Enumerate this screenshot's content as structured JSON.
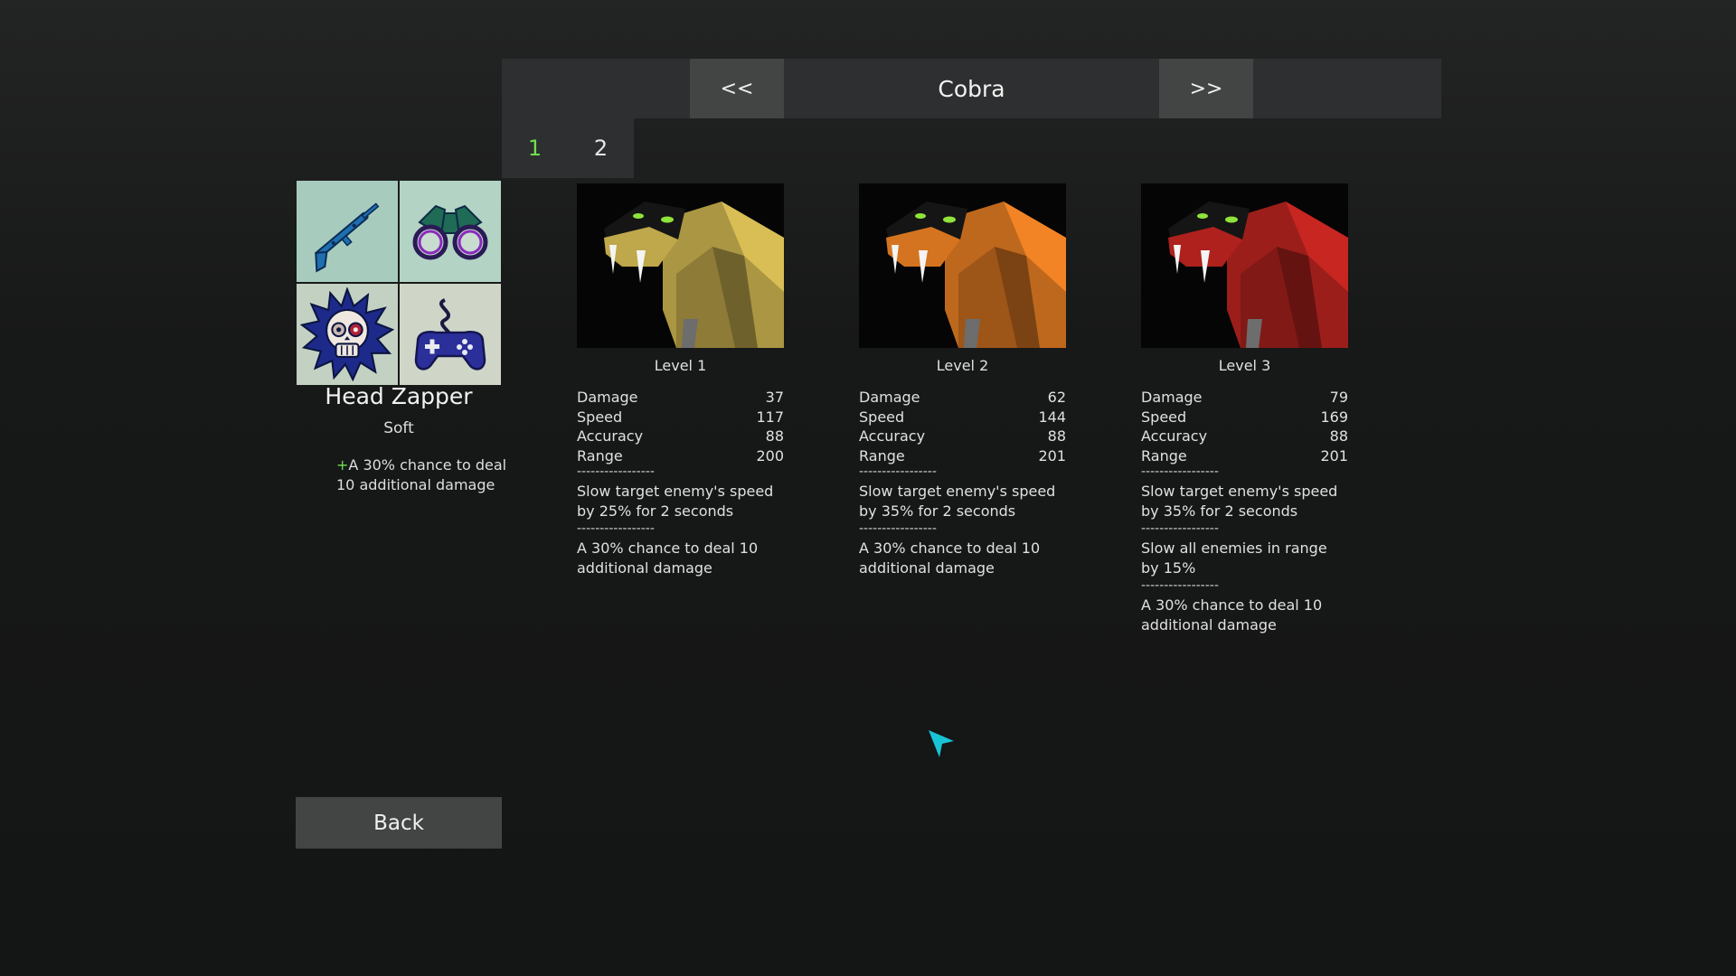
{
  "header": {
    "prev_label": "<<",
    "next_label": ">>",
    "title": "Cobra"
  },
  "pages": [
    {
      "label": "1",
      "active": true
    },
    {
      "label": "2",
      "active": false
    }
  ],
  "upgrade": {
    "name": "Head Zapper",
    "type": "Soft",
    "bonus_prefix": "+",
    "bonus_text": "A 30% chance to deal 10 additional damage",
    "icons": [
      "rifle-icon",
      "binoculars-icon",
      "skull-icon",
      "gamepad-icon"
    ]
  },
  "levels": [
    {
      "label": "Level 1",
      "color": "#c9b04f",
      "stats": [
        {
          "name": "Damage",
          "value": "37"
        },
        {
          "name": "Speed",
          "value": "117"
        },
        {
          "name": "Accuracy",
          "value": "88"
        },
        {
          "name": "Range",
          "value": "200"
        }
      ],
      "effects": [
        "Slow target enemy's speed by 25% for 2 seconds",
        "A 30% chance to deal 10 additional damage"
      ]
    },
    {
      "label": "Level 2",
      "color": "#e07a22",
      "stats": [
        {
          "name": "Damage",
          "value": "62"
        },
        {
          "name": "Speed",
          "value": "144"
        },
        {
          "name": "Accuracy",
          "value": "88"
        },
        {
          "name": "Range",
          "value": "201"
        }
      ],
      "effects": [
        "Slow target enemy's speed by 35% for 2 seconds",
        "A 30% chance to deal 10 additional damage"
      ]
    },
    {
      "label": "Level 3",
      "color": "#b8231f",
      "stats": [
        {
          "name": "Damage",
          "value": "79"
        },
        {
          "name": "Speed",
          "value": "169"
        },
        {
          "name": "Accuracy",
          "value": "88"
        },
        {
          "name": "Range",
          "value": "201"
        }
      ],
      "effects": [
        "Slow target enemy's speed by 35% for 2 seconds",
        "Slow all enemies in range by 15%",
        "A 30% chance to deal 10 additional damage"
      ]
    }
  ],
  "divider_text": "-----------------",
  "back_label": "Back",
  "colors": {
    "accent_green": "#6fe04e",
    "button_bg": "#434444",
    "cursor": "#19c3d6"
  }
}
